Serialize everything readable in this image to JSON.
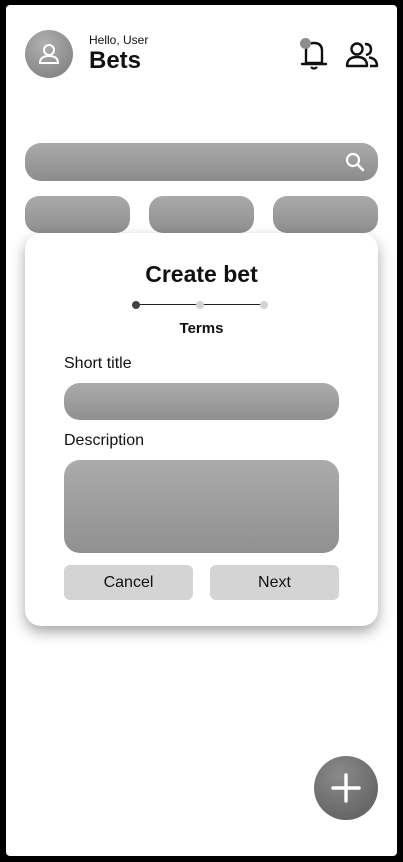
{
  "header": {
    "greeting": "Hello, User",
    "title": "Bets",
    "icons": [
      "user-avatar-icon",
      "bell-icon",
      "friends-icon"
    ]
  },
  "search": {
    "icon": "search-icon"
  },
  "filters": {
    "count": 3
  },
  "modal": {
    "title": "Create bet",
    "step_label": "Terms",
    "steps_total": 3,
    "current_step": 1,
    "fields": {
      "short_title_label": "Short title",
      "short_title_value": "",
      "description_label": "Description",
      "description_value": ""
    },
    "cancel_label": "Cancel",
    "next_label": "Next"
  },
  "fab": {
    "icon": "plus-icon"
  },
  "colors": {
    "background": "#ffffff",
    "frame": "#000000",
    "fill_gray": "#9e9e9e",
    "button_gray": "#d4d4d4",
    "text": "#111111"
  }
}
